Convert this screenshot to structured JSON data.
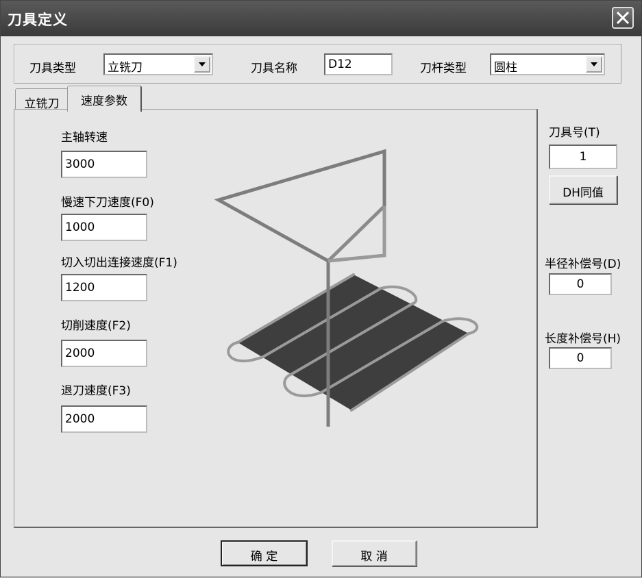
{
  "window": {
    "title": "刀具定义"
  },
  "toolbar": {
    "tool_type_label": "刀具类型",
    "tool_type_value": "立铣刀",
    "tool_name_label": "刀具名称",
    "tool_name_value": "D12",
    "shank_type_label": "刀杆类型",
    "shank_type_value": "圆柱"
  },
  "tabs": [
    {
      "label": "立铣刀",
      "active": false
    },
    {
      "label": "速度参数",
      "active": true
    }
  ],
  "speed_params": {
    "spindle_label": "主轴转速",
    "spindle_value": "3000",
    "slow_down_label": "慢速下刀速度(F0)",
    "slow_down_value": "1000",
    "link_label": "切入切出连接速度(F1)",
    "link_value": "1200",
    "cut_label": "切削速度(F2)",
    "cut_value": "2000",
    "retract_label": "退刀速度(F3)",
    "retract_value": "2000"
  },
  "right_panel": {
    "tool_number_label": "刀具号(T)",
    "tool_number_value": "1",
    "dh_button": "DH同值",
    "radius_comp_label": "半径补偿号(D)",
    "radius_comp_value": "0",
    "length_comp_label": "长度补偿号(H)",
    "length_comp_value": "0"
  },
  "buttons": {
    "ok": "确 定",
    "cancel": "取 消"
  },
  "icons": {
    "close": "close-icon",
    "dropdown": "chevron-down-icon",
    "preview": "toolpath-preview-icon"
  }
}
